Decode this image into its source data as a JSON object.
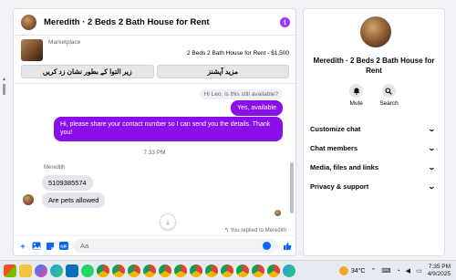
{
  "chat": {
    "title": "Meredith · 2 Beds 2 Bath House for Rent",
    "listing": {
      "marketplace_label": "Marketplace",
      "price_text": "2 Beds 2 Bath House for Rent - $1,500",
      "btn_left": "زیر التوا کے بطور نشان زد کریں",
      "btn_right": "مزید آپشنز"
    },
    "messages": {
      "quote": "Hi Leo, is this still available?",
      "out1": "Yes, available",
      "out2": "Hi, please share your contact number so I can send you the details. Thank you!",
      "timestamp": "7:33 PM",
      "sender": "Meredith",
      "in1": "5109385574",
      "in2": "Are pets allowed",
      "replied": "You replied to Meredith"
    },
    "composer": {
      "placeholder": "Aa"
    }
  },
  "info_panel": {
    "name": "Meredith · 2 Beds 2 Bath House for Rent",
    "actions": [
      {
        "label": "Mute",
        "icon": "bell-icon"
      },
      {
        "label": "Search",
        "icon": "search-icon"
      }
    ],
    "sections": [
      {
        "label": "Customize chat"
      },
      {
        "label": "Chat members"
      },
      {
        "label": "Media, files and links"
      },
      {
        "label": "Privacy & support"
      }
    ]
  },
  "taskbar": {
    "temperature": "34°C",
    "time": "7:35 PM",
    "date": "4/9/2025"
  },
  "colors": {
    "accent": "#8a0fe8",
    "messenger_blue": "#0866ff",
    "info_icon": "#a033ff"
  }
}
